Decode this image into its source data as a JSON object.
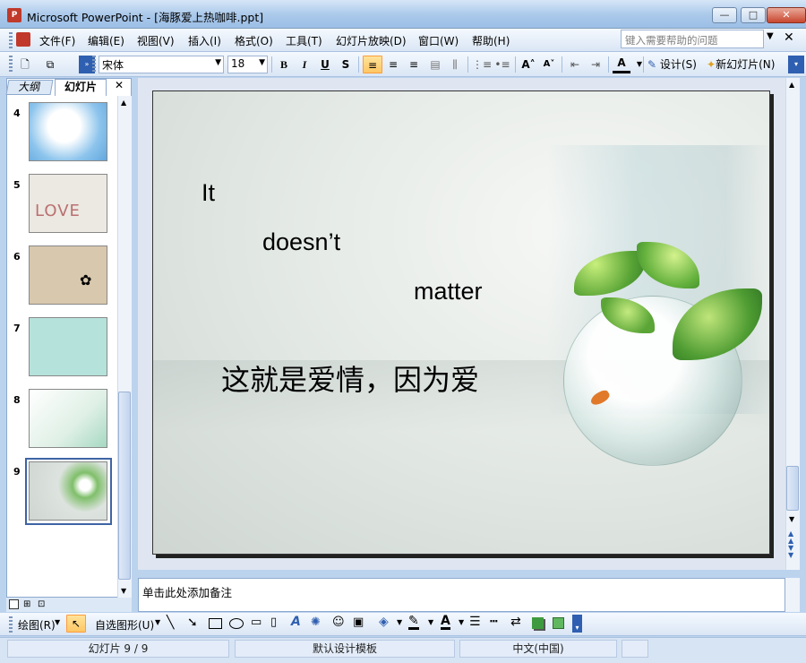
{
  "window": {
    "title": "Microsoft PowerPoint - [海豚爱上热咖啡.ppt]",
    "app_icon_text": "P"
  },
  "menus": [
    "文件(F)",
    "编辑(E)",
    "视图(V)",
    "插入(I)",
    "格式(O)",
    "工具(T)",
    "幻灯片放映(D)",
    "窗口(W)",
    "帮助(H)"
  ],
  "help": {
    "placeholder": "键入需要帮助的问题"
  },
  "toolbar": {
    "font": "宋体",
    "size": "18",
    "bold": "B",
    "italic": "I",
    "underline": "U",
    "shadow": "S",
    "design_label": "设计(S)",
    "new_slide_label": "新幻灯片(N)"
  },
  "panes": {
    "outline_tab": "大纲",
    "slides_tab": "幻灯片"
  },
  "thumbnails": [
    {
      "num": "4"
    },
    {
      "num": "5"
    },
    {
      "num": "6"
    },
    {
      "num": "7"
    },
    {
      "num": "8"
    },
    {
      "num": "9"
    }
  ],
  "slide": {
    "line1": "It",
    "line2": "doesn’t",
    "line3": "matter",
    "line4": "这就是爱情，因为爱"
  },
  "notes": {
    "placeholder": "单击此处添加备注"
  },
  "drawbar": {
    "draw_label": "绘图(R)",
    "autoshapes_label": "自选图形(U)"
  },
  "status": {
    "slide_counter": "幻灯片 9 / 9",
    "template": "默认设计模板",
    "language": "中文(中国)"
  },
  "colors": {
    "titlebar": "#a9c8ea",
    "selection": "#ffc663",
    "slide_bg": "#e7ece8"
  }
}
